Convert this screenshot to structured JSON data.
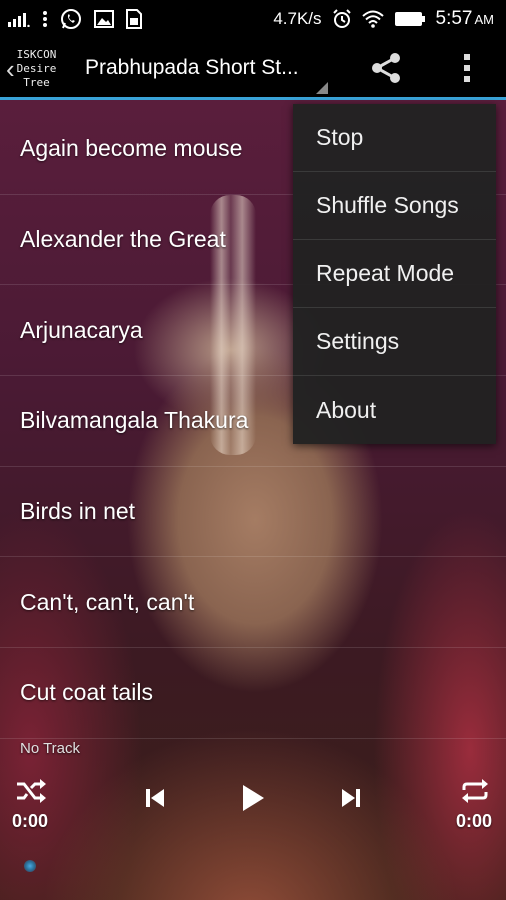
{
  "status_bar": {
    "network_speed": "4.7K/s",
    "time": "5:57",
    "time_suffix": "AM",
    "icons": [
      "signal-icon",
      "more-vert-icon",
      "whatsapp-icon",
      "gallery-icon",
      "sim-card-icon",
      "alarm-icon",
      "wifi-icon",
      "battery-icon"
    ]
  },
  "app_bar": {
    "logo_lines": [
      "ISKCON",
      "Desire",
      "Tree"
    ],
    "title": "Prabhupada Short St...",
    "icons": [
      "back-chevron-icon",
      "share-icon",
      "more-vert-icon"
    ],
    "accent_color": "#3aa3d8"
  },
  "songs": [
    {
      "title": "Again become mouse"
    },
    {
      "title": "Alexander the Great"
    },
    {
      "title": "Arjunacarya"
    },
    {
      "title": "Bilvamangala Thakura"
    },
    {
      "title": "Birds in net"
    },
    {
      "title": "Can't, can't, can't"
    },
    {
      "title": "Cut coat tails"
    }
  ],
  "menu": {
    "items": [
      {
        "label": "Stop"
      },
      {
        "label": "Shuffle Songs"
      },
      {
        "label": "Repeat Mode"
      },
      {
        "label": "Settings"
      },
      {
        "label": "About"
      }
    ]
  },
  "player": {
    "track": "No Track",
    "elapsed": "0:00",
    "duration": "0:00",
    "icons": [
      "shuffle-icon",
      "previous-icon",
      "play-icon",
      "next-icon",
      "repeat-icon"
    ]
  }
}
